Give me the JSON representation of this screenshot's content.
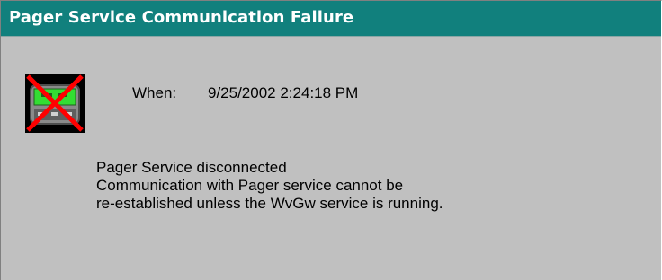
{
  "window": {
    "title": "Pager Service Communication Failure"
  },
  "alert": {
    "icon": "pager-disconnected-icon",
    "when_label": "When:",
    "when_value": "9/25/2002 2:24:18 PM"
  },
  "message": {
    "lines": [
      "Pager Service disconnected",
      "Communication with Pager service cannot be",
      "re-established unless the WvGw service is running."
    ]
  },
  "colors": {
    "title_bar": "#11807d",
    "background": "#c0c0c0",
    "error_cross": "#ff0000",
    "pager_screen": "#33dd33"
  }
}
